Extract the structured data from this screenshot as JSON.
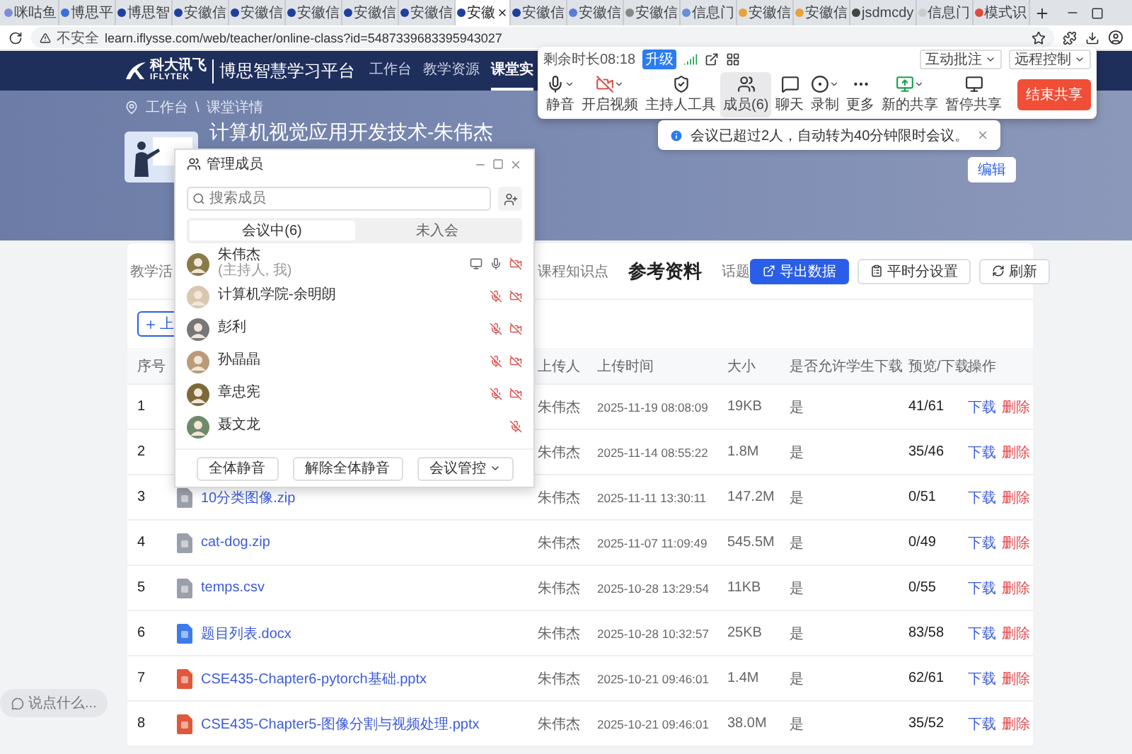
{
  "browser": {
    "tabs": [
      {
        "title": "咪咕鱼",
        "selected": false
      },
      {
        "title": "博思平",
        "selected": false
      },
      {
        "title": "博思智",
        "selected": false
      },
      {
        "title": "安徽信",
        "selected": false
      },
      {
        "title": "安徽信",
        "selected": false
      },
      {
        "title": "安徽信",
        "selected": false
      },
      {
        "title": "安徽信",
        "selected": false
      },
      {
        "title": "安徽信",
        "selected": false
      },
      {
        "title": "安徽",
        "selected": true
      },
      {
        "title": "安徽信",
        "selected": false
      },
      {
        "title": "安徽信",
        "selected": false
      },
      {
        "title": "安徽信",
        "selected": false
      },
      {
        "title": "信息门",
        "selected": false
      },
      {
        "title": "安徽信",
        "selected": false
      },
      {
        "title": "安徽信",
        "selected": false
      },
      {
        "title": "jsdmcdy",
        "selected": false
      },
      {
        "title": "信息门",
        "selected": false
      },
      {
        "title": "模式识",
        "selected": false
      }
    ],
    "address": {
      "security": "不安全",
      "url": "learn.iflysse.com/web/teacher/online-class?id=5487339683395943027"
    }
  },
  "site": {
    "logo_cn": "科大讯飞",
    "logo_en": "IFLYTEK",
    "platform": "博思智慧学习平台",
    "nav": [
      {
        "label": "工作台",
        "selected": false
      },
      {
        "label": "教学资源",
        "selected": false
      },
      {
        "label": "课堂实",
        "selected": true
      }
    ]
  },
  "banner": {
    "breadcrumb": [
      "工作台",
      "课堂详情"
    ],
    "separator": "\\",
    "course_title": "计算机视觉应用开发技术-朱伟杰",
    "edit_button": "编辑"
  },
  "content": {
    "tabs": [
      {
        "label": "教学活",
        "selected": false
      },
      {
        "label": "课程知识点",
        "selected": false
      },
      {
        "label": "参考资料",
        "selected": true
      },
      {
        "label": "话题",
        "selected": false
      }
    ],
    "actions": [
      {
        "label": "导出数据",
        "kind": "primary"
      },
      {
        "label": "平时分设置",
        "kind": "settings"
      },
      {
        "label": "刷新",
        "kind": "refresh"
      }
    ],
    "upload_button": "上",
    "table": {
      "columns": [
        "序号",
        "上传人",
        "上传时间",
        "大小",
        "是否允许学生下载",
        "预览/下载",
        "操作"
      ],
      "rows": [
        {
          "no": "1",
          "uploader": "朱伟杰",
          "time": "2025-11-19 08:08:09",
          "size": "19KB",
          "allow": "是",
          "views": "41/61",
          "actions": [
            "下载",
            "删除"
          ]
        },
        {
          "no": "2",
          "uploader": "朱伟杰",
          "time": "2025-11-14 08:55:22",
          "size": "1.8M",
          "allow": "是",
          "views": "35/46",
          "actions": [
            "下载",
            "删除"
          ]
        },
        {
          "no": "3",
          "name": "10分类图像.zip",
          "kind": "unknown",
          "uploader": "朱伟杰",
          "time": "2025-11-11 13:30:11",
          "size": "147.2M",
          "allow": "是",
          "views": "0/51",
          "actions": [
            "下载",
            "删除"
          ]
        },
        {
          "no": "4",
          "name": "cat-dog.zip",
          "kind": "unknown",
          "uploader": "朱伟杰",
          "time": "2025-11-07 11:09:49",
          "size": "545.5M",
          "allow": "是",
          "views": "0/49",
          "actions": [
            "下载",
            "删除"
          ]
        },
        {
          "no": "5",
          "name": "temps.csv",
          "kind": "unknown",
          "uploader": "朱伟杰",
          "time": "2025-10-28 13:29:54",
          "size": "11KB",
          "allow": "是",
          "views": "0/55",
          "actions": [
            "下载",
            "删除"
          ]
        },
        {
          "no": "6",
          "name": "题目列表.docx",
          "kind": "word",
          "uploader": "朱伟杰",
          "time": "2025-10-28 10:32:57",
          "size": "25KB",
          "allow": "是",
          "views": "83/58",
          "actions": [
            "下载",
            "删除"
          ]
        },
        {
          "no": "7",
          "name": "CSE435-Chapter6-pytorch基础.pptx",
          "kind": "ppt",
          "uploader": "朱伟杰",
          "time": "2025-10-21 09:46:01",
          "size": "1.4M",
          "allow": "是",
          "views": "62/61",
          "actions": [
            "下载",
            "删除"
          ]
        },
        {
          "no": "8",
          "name": "CSE435-Chapter5-图像分割与视频处理.pptx",
          "kind": "ppt",
          "uploader": "朱伟杰",
          "time": "2025-10-21 09:46:01",
          "size": "38.0M",
          "allow": "是",
          "views": "35/52",
          "actions": [
            "下载",
            "删除"
          ]
        }
      ]
    }
  },
  "chat_pill": "说点什么...",
  "meeting_toolbar": {
    "remaining": "剩余时长08:18",
    "upgrade": "升级",
    "top_buttons": [
      "互动批注",
      "远程控制"
    ],
    "tools": [
      {
        "kind": "mic",
        "label": "静音",
        "dropdown": true,
        "selected": false
      },
      {
        "kind": "video_off",
        "label": "开启视频",
        "dropdown": true,
        "selected": false
      },
      {
        "kind": "host",
        "label": "主持人工具",
        "dropdown": false,
        "selected": false
      },
      {
        "kind": "members",
        "label": "成员(6)",
        "dropdown": false,
        "selected": true
      },
      {
        "kind": "chat",
        "label": "聊天",
        "dropdown": false,
        "selected": false
      },
      {
        "kind": "record",
        "label": "录制",
        "dropdown": true,
        "selected": false
      },
      {
        "kind": "more",
        "label": "更多",
        "dropdown": false,
        "selected": false
      },
      {
        "kind": "share",
        "label": "新的共享",
        "dropdown": true,
        "selected": false
      },
      {
        "kind": "pause_share",
        "label": "暂停共享",
        "dropdown": false,
        "selected": false
      }
    ],
    "end_button": "结束共享"
  },
  "notice": {
    "text": "会议已超过2人，自动转为40分钟限时会议。"
  },
  "members_dialog": {
    "title": "管理成员",
    "search_placeholder": "搜索成员",
    "tabs": [
      {
        "label": "会议中(6)",
        "selected": true
      },
      {
        "label": "未入会",
        "selected": false
      }
    ],
    "members": [
      {
        "name": "朱伟杰",
        "role": "(主持人, 我)",
        "sharing": true,
        "mic_on": true,
        "camera_shown": true
      },
      {
        "name": "计算机学院-余明朗",
        "sharing": false,
        "mic_on": false,
        "camera_shown": true
      },
      {
        "name": "彭利",
        "sharing": false,
        "mic_on": false,
        "camera_shown": true
      },
      {
        "name": "孙晶晶",
        "sharing": false,
        "mic_on": false,
        "camera_shown": true
      },
      {
        "name": "章忠宪",
        "sharing": false,
        "mic_on": false,
        "camera_shown": true
      },
      {
        "name": "聂文龙",
        "sharing": false,
        "mic_on": false,
        "camera_shown": false
      }
    ],
    "footer": [
      "全体静音",
      "解除全体静音"
    ],
    "control_menu": "会议管控"
  }
}
